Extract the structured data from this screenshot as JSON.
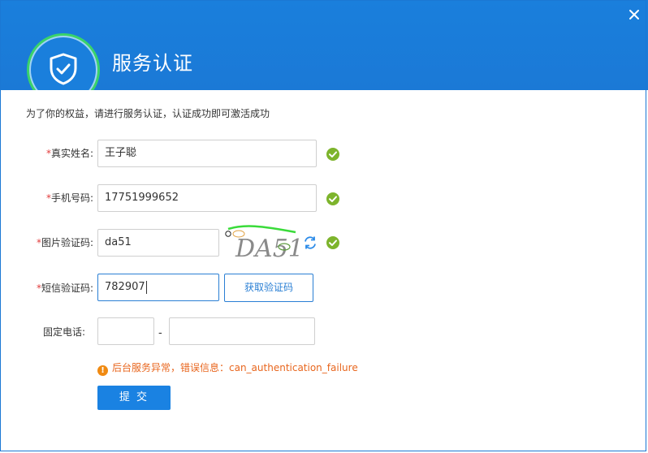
{
  "dialog": {
    "title": "服务认证",
    "description": "为了你的权益，请进行服务认证，认证成功即可激活成功"
  },
  "form": {
    "real_name": {
      "required_mark": "*",
      "label": "真实姓名:",
      "value": "王子聪",
      "valid": true
    },
    "phone": {
      "required_mark": "*",
      "label": "手机号码:",
      "value": "17751999652",
      "valid": true
    },
    "image_captcha": {
      "required_mark": "*",
      "label": "图片验证码:",
      "value": "da51",
      "captcha_text": "DA51",
      "valid": true
    },
    "sms_code": {
      "required_mark": "*",
      "label": "短信验证码:",
      "value": "782907",
      "button_label": "获取验证码"
    },
    "landline": {
      "label": "固定电话:",
      "area_code": "",
      "number": "",
      "separator": "-"
    }
  },
  "error": {
    "icon": "warning-icon",
    "message": "后台服务异常，错误信息：can_authentication_failure"
  },
  "submit_label": "提 交",
  "colors": {
    "header": "#1a7fdc",
    "accent": "#2a7fd4",
    "success": "#7db42c",
    "error": "#e8661e",
    "required": "#e23c3c"
  }
}
